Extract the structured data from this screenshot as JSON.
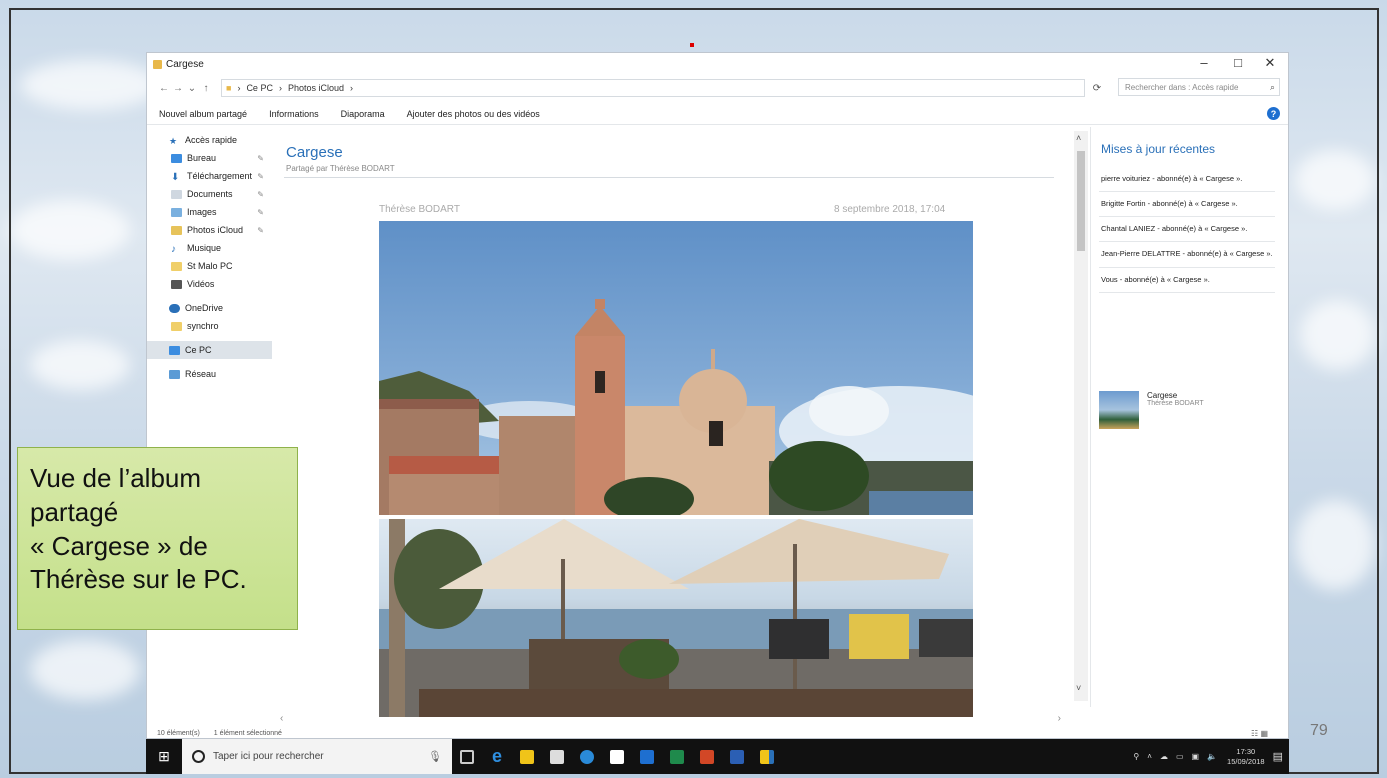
{
  "window": {
    "title": "Cargese",
    "controls": {
      "minimize": "–",
      "maximize": "□",
      "close": "✕"
    }
  },
  "address": {
    "path": [
      "Ce PC",
      "Photos iCloud"
    ],
    "search_placeholder": "Rechercher dans : Accès rapide"
  },
  "ribbon": {
    "commands": [
      "Nouvel album partagé",
      "Informations",
      "Diaporama",
      "Ajouter des photos ou des vidéos"
    ]
  },
  "navpane": {
    "items": [
      {
        "label": "Accès rapide",
        "icon": "star-icon"
      },
      {
        "label": "Bureau",
        "icon": "desktop-folder-icon"
      },
      {
        "label": "Téléchargement",
        "icon": "download-icon"
      },
      {
        "label": "Documents",
        "icon": "documents-icon"
      },
      {
        "label": "Images",
        "icon": "images-icon"
      },
      {
        "label": "Photos iCloud",
        "icon": "icloud-photos-icon"
      },
      {
        "label": "Musique",
        "icon": "music-icon"
      },
      {
        "label": "St Malo PC",
        "icon": "folder-icon"
      },
      {
        "label": "Vidéos",
        "icon": "videos-icon"
      },
      {
        "label": "OneDrive",
        "icon": "onedrive-icon"
      },
      {
        "label": "synchro",
        "icon": "folder-icon"
      },
      {
        "label": "Ce PC",
        "icon": "pc-icon"
      },
      {
        "label": "Réseau",
        "icon": "network-icon"
      }
    ]
  },
  "album": {
    "title": "Cargese",
    "subtitle": "Partagé par Thérèse BODART",
    "post_author": "Thérèse BODART",
    "post_date": "8 septembre 2018, 17:04"
  },
  "updates": {
    "title": "Mises à jour récentes",
    "items": [
      "pierre voituriez - abonné(e) à « Cargese ».",
      "Brigitte Fortin - abonné(e) à « Cargese ».",
      "Chantal LANIEZ - abonné(e) à « Cargese ».",
      "Jean-Pierre DELATTRE - abonné(e) à « Cargese ».",
      "Vous - abonné(e) à « Cargese »."
    ],
    "album_card": {
      "name": "Cargese",
      "by": "Thérèse BODART"
    }
  },
  "status": {
    "count": "10 élément(s)",
    "selection": "1 élément sélectionné"
  },
  "taskbar": {
    "search_placeholder": "Taper ici pour rechercher",
    "time": "17:30",
    "date": "15/09/2018"
  },
  "callout": {
    "lines": [
      "Vue de l’album",
      "partagé",
      "« Cargese » de",
      "Thérèse sur le PC."
    ]
  },
  "slide_number": "79",
  "colors": {
    "accent": "#2a70b8",
    "callout_bg": "#c9e394",
    "taskbar": "#111111"
  }
}
